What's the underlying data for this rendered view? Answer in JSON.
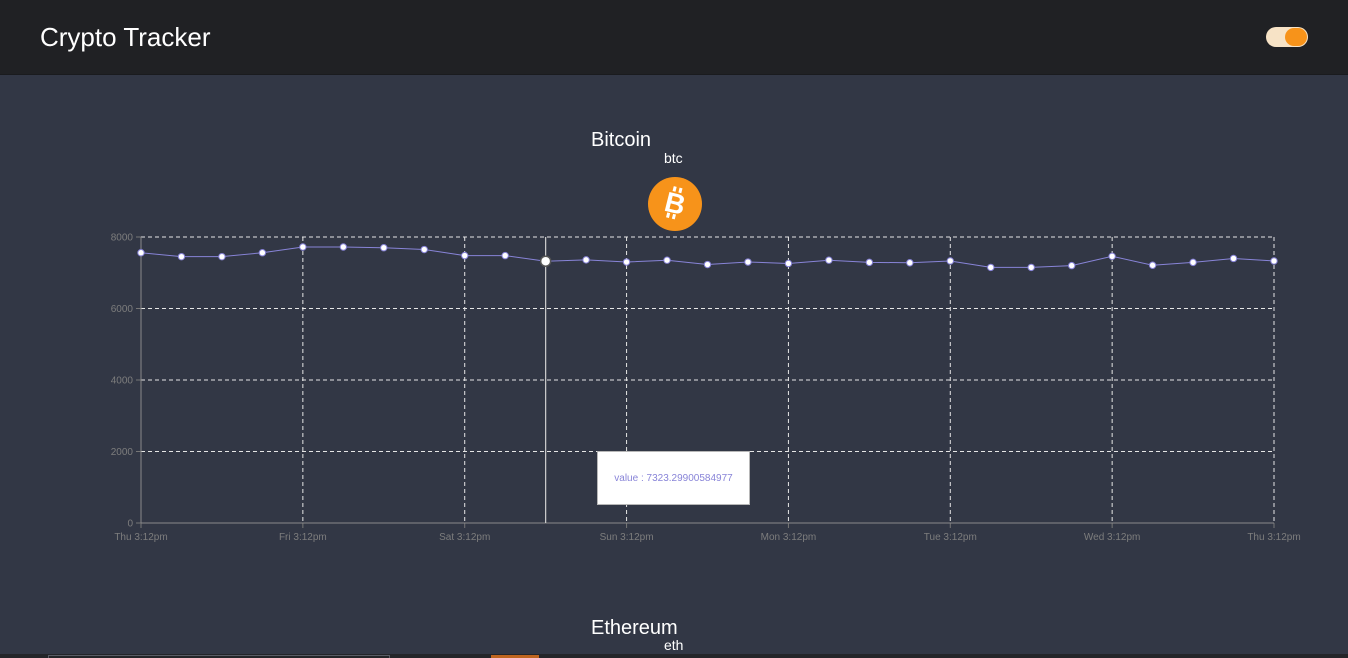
{
  "header": {
    "title": "Crypto Tracker",
    "toggle_state": "on",
    "toggle_color": "#f7931a"
  },
  "coins": [
    {
      "name": "Bitcoin",
      "symbol": "btc",
      "logo_icon": "bitcoin-icon",
      "logo_color": "#f7931a"
    },
    {
      "name": "Ethereum",
      "symbol": "eth"
    }
  ],
  "tooltip": {
    "text": "value : 7323.29900584977"
  },
  "chart_data": {
    "type": "line",
    "title": "",
    "xlabel": "",
    "ylabel": "",
    "ylim": [
      0,
      8000
    ],
    "y_ticks": [
      0,
      2000,
      4000,
      6000,
      8000
    ],
    "x_tick_labels": [
      "Thu 3:12pm",
      "Fri 3:12pm",
      "Sat 3:12pm",
      "Sun 3:12pm",
      "Mon 3:12pm",
      "Tue 3:12pm",
      "Wed 3:12pm",
      "Thu 3:12pm"
    ],
    "grid": true,
    "line_color": "#8884d8",
    "series": [
      {
        "name": "value",
        "values": [
          7560,
          7450,
          7450,
          7560,
          7720,
          7720,
          7700,
          7650,
          7480,
          7480,
          7323.29900584977,
          7360,
          7300,
          7350,
          7230,
          7300,
          7260,
          7350,
          7290,
          7280,
          7330,
          7150,
          7150,
          7200,
          7460,
          7210,
          7290,
          7400,
          7330
        ]
      }
    ],
    "active_index": 10
  }
}
